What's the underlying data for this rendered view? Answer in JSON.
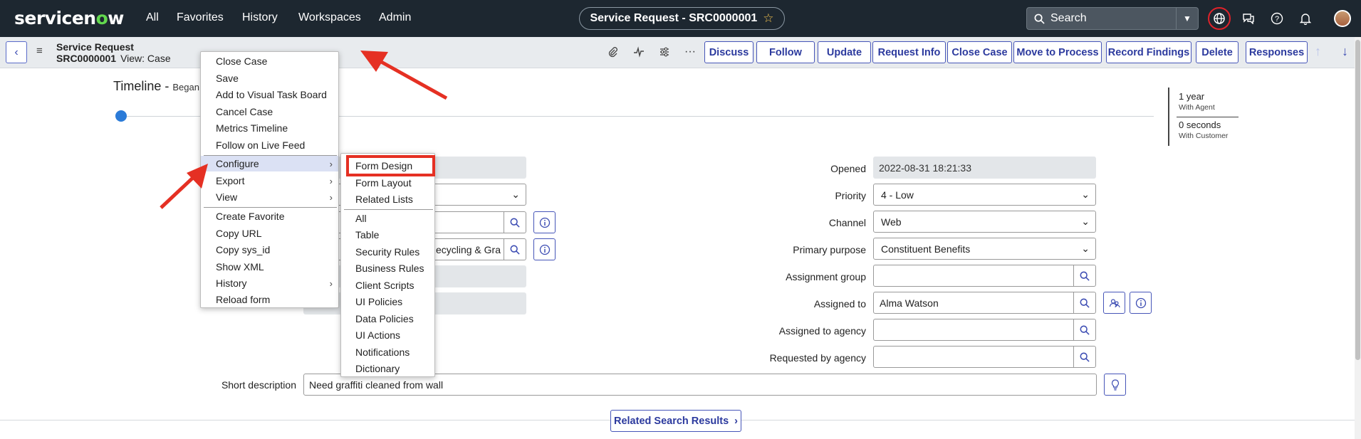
{
  "topnav": {
    "logo": "servicenow",
    "links": [
      "All",
      "Favorites",
      "History",
      "Workspaces",
      "Admin"
    ],
    "record_title": "Service Request - SRC0000001",
    "search_placeholder": "Search"
  },
  "header": {
    "record_type": "Service Request",
    "record_number": "SRC0000001",
    "view": "View: Case",
    "buttons": [
      "Discuss",
      "Follow",
      "Update",
      "Request Info",
      "Close Case",
      "Move to Process",
      "Record Findings",
      "Delete",
      "Responses"
    ]
  },
  "timeline": {
    "title": "Timeline - ",
    "began": "Began"
  },
  "sla": {
    "agent_value": "1 year",
    "agent_label": "With Agent",
    "customer_value": "0 seconds",
    "customer_label": "With Customer"
  },
  "form": {
    "left_field_partial": "Recycling & Gra",
    "opened": {
      "label": "Opened",
      "value": "2022-08-31 18:21:33"
    },
    "priority": {
      "label": "Priority",
      "value": "4 - Low"
    },
    "channel": {
      "label": "Channel",
      "value": "Web"
    },
    "primary_purpose": {
      "label": "Primary purpose",
      "value": "Constituent Benefits"
    },
    "assignment_group": {
      "label": "Assignment group",
      "value": ""
    },
    "assigned_to": {
      "label": "Assigned to",
      "value": "Alma Watson"
    },
    "assigned_to_agency": {
      "label": "Assigned to agency",
      "value": ""
    },
    "requested_by_agency": {
      "label": "Requested by agency",
      "value": ""
    },
    "short_description": {
      "label": "Short description",
      "value": "Need graffiti cleaned from wall"
    }
  },
  "related_search": "Related Search Results",
  "context_menu": {
    "items": [
      {
        "label": "Close Case"
      },
      {
        "label": "Save"
      },
      {
        "label": "Add to Visual Task Board"
      },
      {
        "label": "Cancel Case"
      },
      {
        "label": "Metrics Timeline"
      },
      {
        "label": "Follow on Live Feed"
      },
      {
        "label": "Configure"
      },
      {
        "label": "Export"
      },
      {
        "label": "View"
      },
      {
        "label": "Create Favorite"
      },
      {
        "label": "Copy URL"
      },
      {
        "label": "Copy sys_id"
      },
      {
        "label": "Show XML"
      },
      {
        "label": "History"
      },
      {
        "label": "Reload form"
      }
    ]
  },
  "configure_submenu": {
    "items": [
      "Form Design",
      "Form Layout",
      "Related Lists",
      "All",
      "Table",
      "Security Rules",
      "Business Rules",
      "Client Scripts",
      "UI Policies",
      "Data Policies",
      "UI Actions",
      "Notifications",
      "Dictionary"
    ]
  },
  "colors": {
    "nav_bg": "#1d2730",
    "accent": "#3d4db3",
    "highlight": "#e53023",
    "logo_green": "#62d84e"
  }
}
